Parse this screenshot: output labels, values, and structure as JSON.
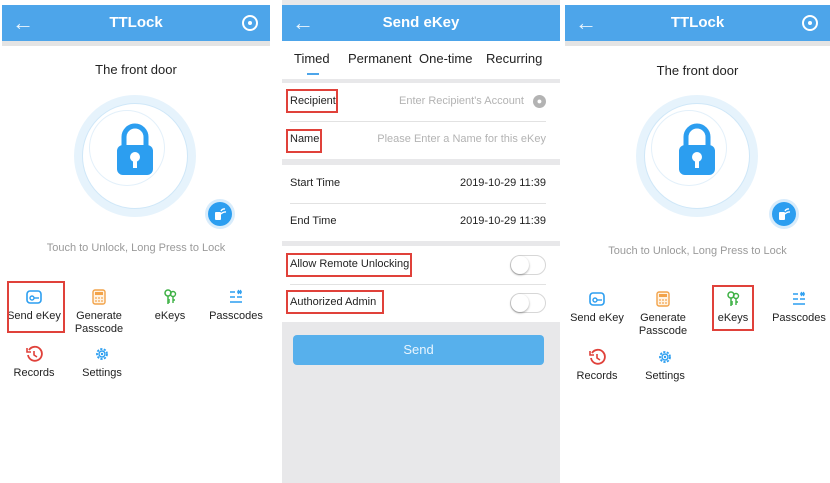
{
  "colors": {
    "accent": "#4da5ea",
    "highlight_box": "#e0413a",
    "key_green": "#3cb043",
    "record_red": "#e0413a",
    "calc_orange": "#f2a34a"
  },
  "screen1": {
    "header": {
      "back_icon": "arrow-left-icon",
      "title": "TTLock",
      "right_icon": "target-icon"
    },
    "lock_name": "The front door",
    "hint": "Touch to Unlock, Long Press to Lock",
    "menu": [
      {
        "label": "Send eKey",
        "icon": "send-ekey-icon"
      },
      {
        "label": "Generate\nPasscode",
        "icon": "calculator-icon"
      },
      {
        "label": "eKeys",
        "icon": "keys-icon"
      },
      {
        "label": "Passcodes",
        "icon": "passcode-list-icon"
      },
      {
        "label": "Records",
        "icon": "history-icon"
      },
      {
        "label": "Settings",
        "icon": "gear-icon"
      }
    ]
  },
  "screen2": {
    "header": {
      "back_icon": "arrow-left-icon",
      "title": "Send eKey"
    },
    "tabs": [
      "Timed",
      "Permanent",
      "One-time",
      "Recurring"
    ],
    "active_tab": "Timed",
    "fields": {
      "recipient_label": "Recipient",
      "recipient_placeholder": "Enter Recipient's Account",
      "name_label": "Name",
      "name_placeholder": "Please Enter a Name for this eKey",
      "start_label": "Start Time",
      "start_value": "2019-10-29 11:39",
      "end_label": "End Time",
      "end_value": "2019-10-29 11:39",
      "remote_label": "Allow Remote Unlocking",
      "admin_label": "Authorized Admin"
    },
    "send_label": "Send"
  },
  "screen3": {
    "header": {
      "back_icon": "arrow-left-icon",
      "title": "TTLock",
      "right_icon": "target-icon"
    },
    "lock_name": "The front door",
    "hint": "Touch to Unlock, Long Press to Lock",
    "menu": [
      {
        "label": "Send eKey"
      },
      {
        "label": "Generate\nPasscode"
      },
      {
        "label": "eKeys"
      },
      {
        "label": "Passcodes"
      },
      {
        "label": "Records"
      },
      {
        "label": "Settings"
      }
    ]
  }
}
